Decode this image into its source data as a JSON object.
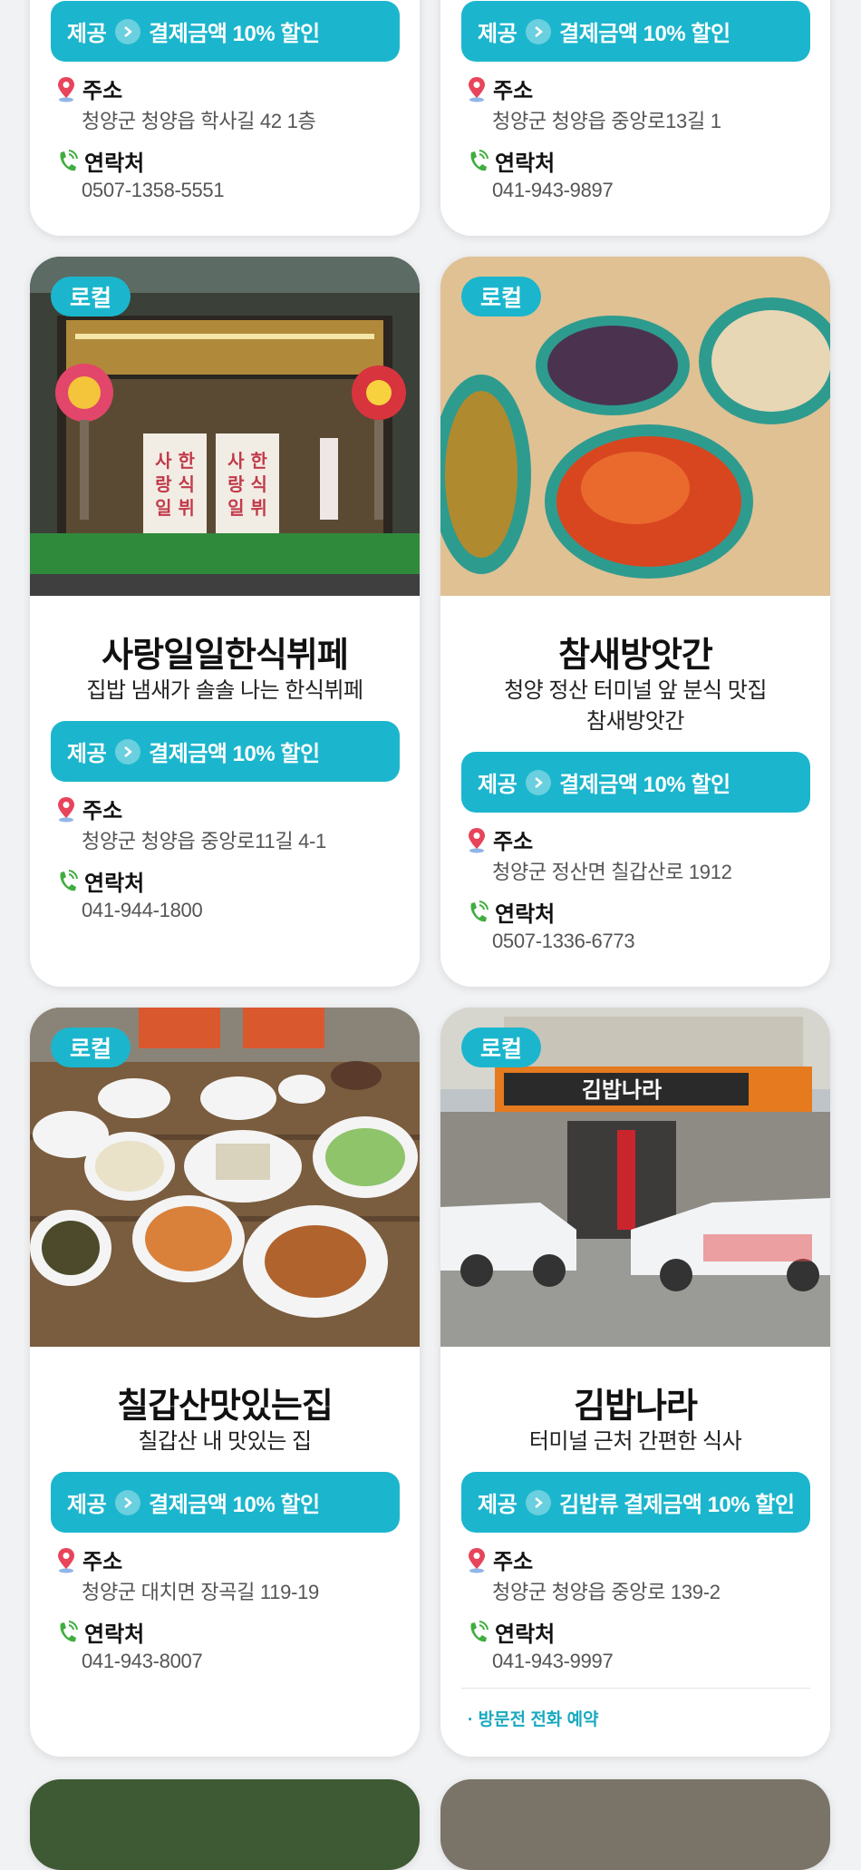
{
  "common": {
    "local_badge": "로컬",
    "offer_label": "제공",
    "address_label": "주소",
    "contact_label": "연락처"
  },
  "cards": [
    {
      "offer": "결제금액 10% 할인",
      "address": "청양군 청양읍 학사길 42 1층",
      "phone": "0507-1358-5551"
    },
    {
      "offer": "결제금액 10% 할인",
      "address": "청양군 청양읍 중앙로13길 1",
      "phone": "041-943-9897"
    },
    {
      "title": "사랑일일한식뷔페",
      "desc": "집밥 냄새가 솔솔 나는 한식뷔페",
      "offer": "결제금액 10% 할인",
      "address": "청양군 청양읍 중앙로11길 4-1",
      "phone": "041-944-1800"
    },
    {
      "title": "참새방앗간",
      "desc_line1": "청양 정산 터미널 앞 분식 맛집",
      "desc_line2": "참새방앗간",
      "offer": "결제금액 10% 할인",
      "address": "청양군 정산면 칠갑산로 1912",
      "phone": "0507-1336-6773"
    },
    {
      "title": "칠갑산맛있는집",
      "desc": "칠갑산 내 맛있는 집",
      "offer": "결제금액 10% 할인",
      "address": "청양군 대치면 장곡길 119-19",
      "phone": "041-943-8007"
    },
    {
      "title": "김밥나라",
      "desc": "터미널 근처 간편한 식사",
      "offer": "김밥류 결제금액 10% 할인",
      "address": "청양군 청양읍 중앙로 139-2",
      "phone": "041-943-9997",
      "note": "· 방문전 전화 예약"
    }
  ],
  "photo_text": {
    "sign": "김밥나라"
  },
  "colors": {
    "accent": "#1bb6cd",
    "pin": "#e8445a",
    "phone": "#3fae3f"
  }
}
